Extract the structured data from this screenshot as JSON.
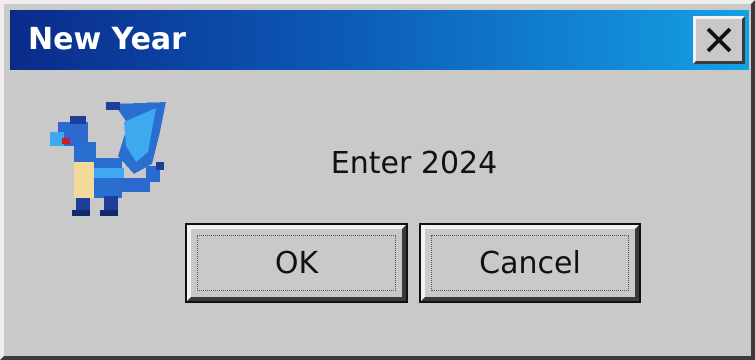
{
  "window": {
    "title": "New Year",
    "close_icon": "close-x-icon",
    "accent_gradient": [
      "#0b2b8a",
      "#15a0e4"
    ]
  },
  "dialog": {
    "icon": "pixel-dragon-icon",
    "message": "Enter 2024"
  },
  "buttons": {
    "ok_label": "OK",
    "cancel_label": "Cancel"
  }
}
